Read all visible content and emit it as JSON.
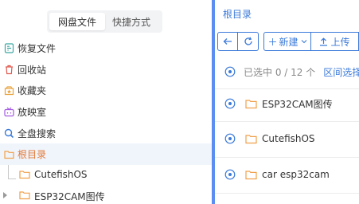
{
  "sidebar": {
    "tabs": [
      {
        "label": "网盘文件",
        "active": true
      },
      {
        "label": "快捷方式",
        "active": false
      }
    ],
    "nav": [
      {
        "label": "恢复文件",
        "icon": "restore-file-icon"
      },
      {
        "label": "回收站",
        "icon": "trash-icon"
      },
      {
        "label": "收藏夹",
        "icon": "favorites-icon"
      },
      {
        "label": "放映室",
        "icon": "tv-icon"
      },
      {
        "label": "全盘搜索",
        "icon": "search-icon"
      },
      {
        "label": "根目录",
        "icon": "folder-icon",
        "selected": true
      }
    ],
    "tree": [
      {
        "label": "CutefishOS"
      },
      {
        "label": "ESP32CAM图传"
      }
    ]
  },
  "main": {
    "breadcrumb": "根目录",
    "toolbar": {
      "new_label": "新建",
      "upload_label": "上传"
    },
    "selection": {
      "text": "已选中 0 / 12 个",
      "range_label": "区间选择"
    },
    "files": [
      {
        "name": "ESP32CAM图传"
      },
      {
        "name": "CutefishOS"
      },
      {
        "name": "car esp32cam"
      }
    ]
  },
  "colors": {
    "accent": "#3b7ad9",
    "folder": "#f0a04b",
    "divider": "#5b8ef0",
    "selected_bg": "#f0f4fb",
    "selected_text": "#e37a39"
  }
}
